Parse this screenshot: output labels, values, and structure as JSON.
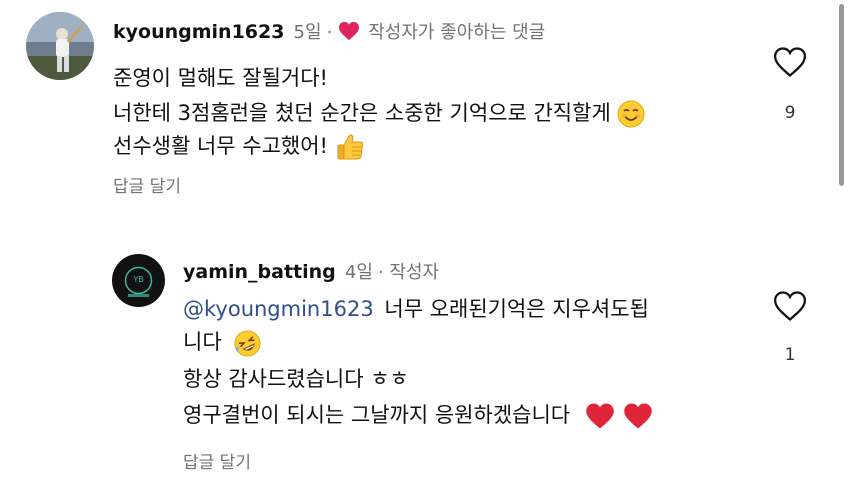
{
  "comments": [
    {
      "username": "kyoungmin1623",
      "time": "5일",
      "liked_by_author_label": "작성자가 좋아하는 댓글",
      "lines": [
        "준영이 멀해도 잘될거다!",
        "너한테 3점홈런을 쳤던 순간은 소중한 기억으로 간직할게",
        "선수생활 너무 수고했어!"
      ],
      "reply_label": "답글 달기",
      "like_count": "9"
    },
    {
      "username": "yamin_batting",
      "time": "4일",
      "author_badge": "작성자",
      "mention": "@kyoungmin1623",
      "lines": [
        "너무 오래된기억은 지우셔도됩",
        "니다",
        "항상 감사드렸습니다 ㅎㅎ",
        "영구결번이 되시는 그날까지 응원하겠습니다"
      ],
      "reply_label": "답글 달기",
      "like_count": "1"
    }
  ],
  "colors": {
    "heart_red": "#e0245e",
    "meta_gray": "#737373",
    "mention_blue": "#2f4f8a"
  },
  "icons": [
    "heart-filled-icon",
    "heart-outline-icon",
    "smiling-face-emoji",
    "thumbs-up-emoji",
    "rofl-emoji",
    "red-heart-emoji"
  ]
}
